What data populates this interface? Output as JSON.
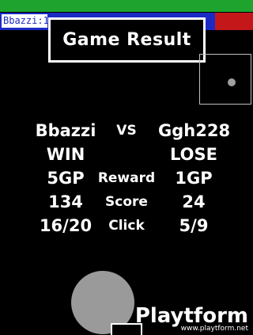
{
  "hud": {
    "player_tag": "Bbazzi:1",
    "colors": {
      "top_bar": "#1fa32f",
      "team_blue": "#1c2ac4",
      "team_red": "#c4171a"
    }
  },
  "result": {
    "title": "Game Result"
  },
  "stats": {
    "vs_label": "VS",
    "player1_name": "Bbazzi",
    "player2_name": "Ggh228",
    "player1_outcome": "WIN",
    "player2_outcome": "LOSE",
    "reward_label": "Reward",
    "player1_reward": "5GP",
    "player2_reward": "1GP",
    "score_label": "Score",
    "player1_score": "134",
    "player2_score": "24",
    "click_label": "Click",
    "player1_click": "16/20",
    "player2_click": "5/9"
  },
  "watermark": {
    "brand": "Playtform",
    "url": "www.playtform.net"
  }
}
